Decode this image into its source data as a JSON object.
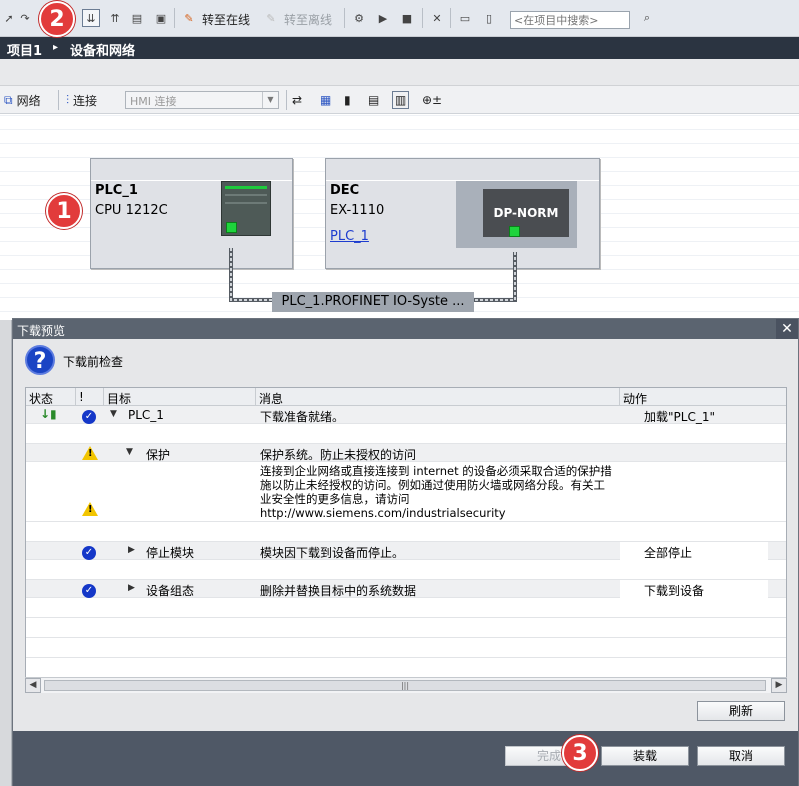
{
  "top_toolbar": {
    "go_online": "转至在线",
    "go_offline": "转至离线",
    "search_placeholder": "<在项目中搜索>"
  },
  "breadcrumb": {
    "project": "项目1",
    "separator": "▸",
    "section": "设备和网络"
  },
  "network_toolbar": {
    "network_label": "网络",
    "connection_label": "连接",
    "connection_type": "HMI 连接"
  },
  "canvas": {
    "devices": [
      {
        "name": "PLC_1",
        "type": "CPU 1212C"
      },
      {
        "name": "DEC",
        "type": "EX-1110",
        "link": "PLC_1",
        "module_label": "DP-NORM"
      }
    ],
    "network_label": "PLC_1.PROFINET  IO-Syste ..."
  },
  "annotations": [
    "1",
    "2",
    "3"
  ],
  "dialog": {
    "title": "下载预览",
    "heading": "下载前检查",
    "columns": [
      "状态",
      "!",
      "目标",
      "消息",
      "动作"
    ],
    "rows": [
      {
        "target": "PLC_1",
        "message": "下载准备就绪。",
        "action": "加载\"PLC_1\""
      },
      {
        "target": "保护",
        "message": "保护系统。防止未授权的访问"
      },
      {
        "message": "连接到企业网络或直接连接到 internet 的设备必须采取合适的保护措施以防止未经授权的访问。例如通过使用防火墙或网络分段。有关工业安全性的更多信息，请访问",
        "url": "http://www.siemens.com/industrialsecurity"
      },
      {
        "target": "停止模块",
        "message": "模块因下载到设备而停止。",
        "action": "全部停止"
      },
      {
        "target": "设备组态",
        "message": "删除并替换目标中的系统数据",
        "action": "下载到设备"
      }
    ],
    "refresh_label": "刷新",
    "finish_label": "完成",
    "load_label": "装载",
    "cancel_label": "取消",
    "close_symbol": "✕"
  }
}
